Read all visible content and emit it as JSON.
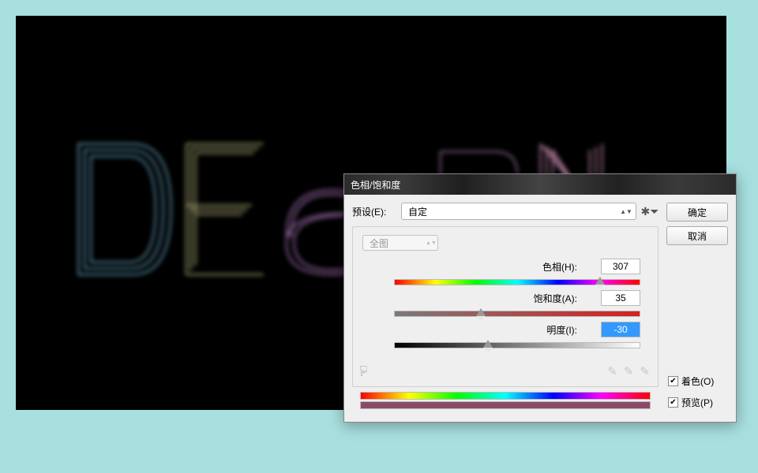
{
  "dialog": {
    "title": "色相/饱和度",
    "preset_label": "预设(E):",
    "preset_value": "自定",
    "master_value": "全图",
    "hue_label": "色相(H):",
    "hue_value": "307",
    "sat_label": "饱和度(A):",
    "sat_value": "35",
    "lig_label": "明度(I):",
    "lig_value": "-30",
    "colorize_label": "着色(O)",
    "preview_label": "预览(P)",
    "ok": "确定",
    "cancel": "取消"
  }
}
